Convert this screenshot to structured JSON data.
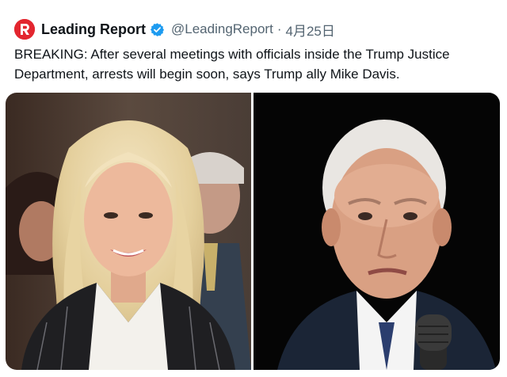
{
  "tweet": {
    "author": {
      "display_name": "Leading Report",
      "handle": "@LeadingReport",
      "avatar_icon": "leading-report-logo-icon",
      "verified_icon": "verified-badge-icon",
      "brand_color": "#e3262f",
      "verified_color": "#1d9bf0"
    },
    "separator": "·",
    "date": "4月25日",
    "text_lines": [
      "BREAKING: After several meetings with officials inside the Trump Justice",
      "Department, arrests will begin soon, says Trump ally Mike Davis."
    ],
    "media": [
      {
        "kind": "photo",
        "description_icon": "portrait-woman-photo"
      },
      {
        "kind": "photo",
        "description_icon": "portrait-man-photo"
      }
    ]
  }
}
